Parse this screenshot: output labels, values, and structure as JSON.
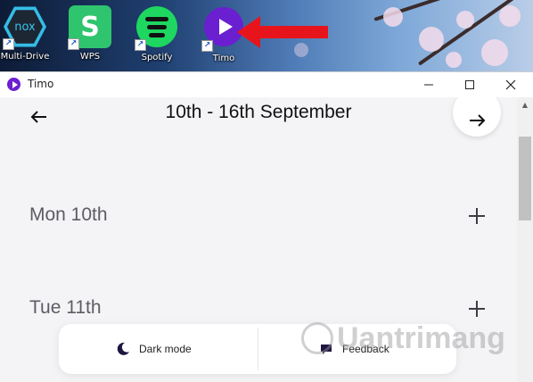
{
  "desktop": {
    "icons": [
      {
        "label": "Multi-Drive",
        "icon": "nox-icon",
        "text": "nox"
      },
      {
        "label": "WPS",
        "icon": "wps-icon",
        "text": "S"
      },
      {
        "label": "Spotify",
        "icon": "spotify-icon"
      },
      {
        "label": "Timo",
        "icon": "timo-icon"
      }
    ],
    "annotation_color": "#e8141b"
  },
  "window": {
    "title": "Timo",
    "controls": {
      "minimize": "—",
      "maximize": "☐",
      "close": "✕"
    }
  },
  "week": {
    "title": "10th - 16th September",
    "prev_icon": "arrow-left-icon",
    "next_icon": "arrow-right-icon"
  },
  "days": [
    {
      "label": "Mon 10th",
      "action_icon": "plus-icon"
    },
    {
      "label": "Tue 11th",
      "action_icon": "plus-icon"
    }
  ],
  "bottom_bar": {
    "dark_mode_label": "Dark mode",
    "feedback_label": "Feedback"
  },
  "watermark": {
    "text": "Uantrimang"
  },
  "colors": {
    "accent": "#6a1fd0",
    "background": "#f4f4f6",
    "text": "#111111",
    "day_text": "#5c5c64"
  }
}
